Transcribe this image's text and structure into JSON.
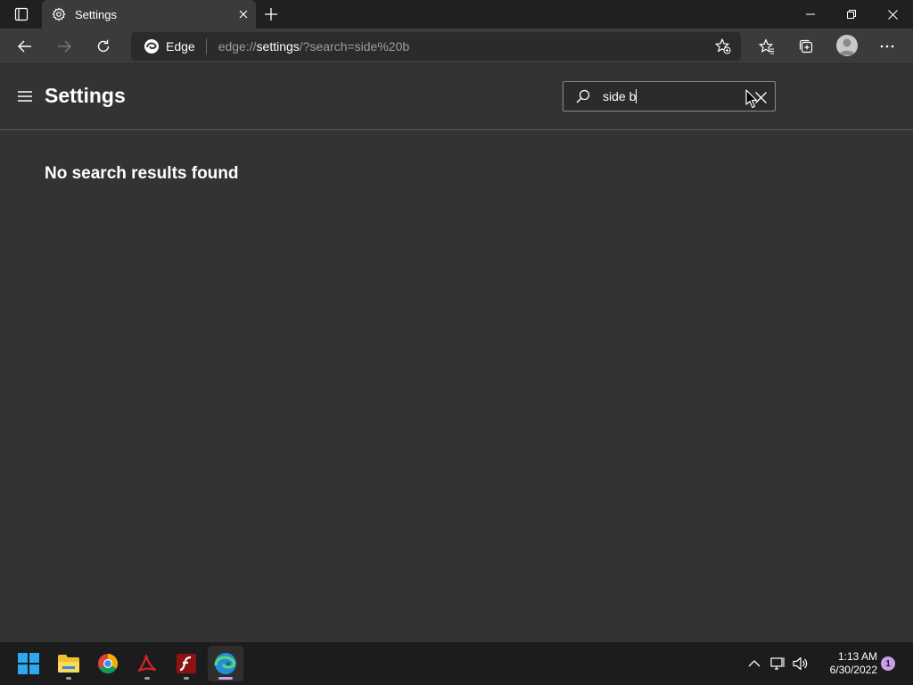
{
  "browser": {
    "tab_title": "Settings",
    "site_name": "Edge",
    "url_prefix": "edge://",
    "url_host": "settings",
    "url_rest": "/?search=side%20b"
  },
  "settings": {
    "title": "Settings",
    "search_value": "side b",
    "no_results_text": "No search results found"
  },
  "taskbar": {
    "apps": [
      "start-icon",
      "file-explorer-icon",
      "chrome-icon",
      "acrobat-icon",
      "flash-icon",
      "edge-icon"
    ],
    "time": "1:13 AM",
    "date": "6/30/2022",
    "notification_count": "1"
  },
  "colors": {
    "accent": "#c7a0e8",
    "background": "#333333",
    "titlebar": "#202020",
    "toolbar": "#3b3b3b",
    "taskbar": "#1c1c1c"
  }
}
